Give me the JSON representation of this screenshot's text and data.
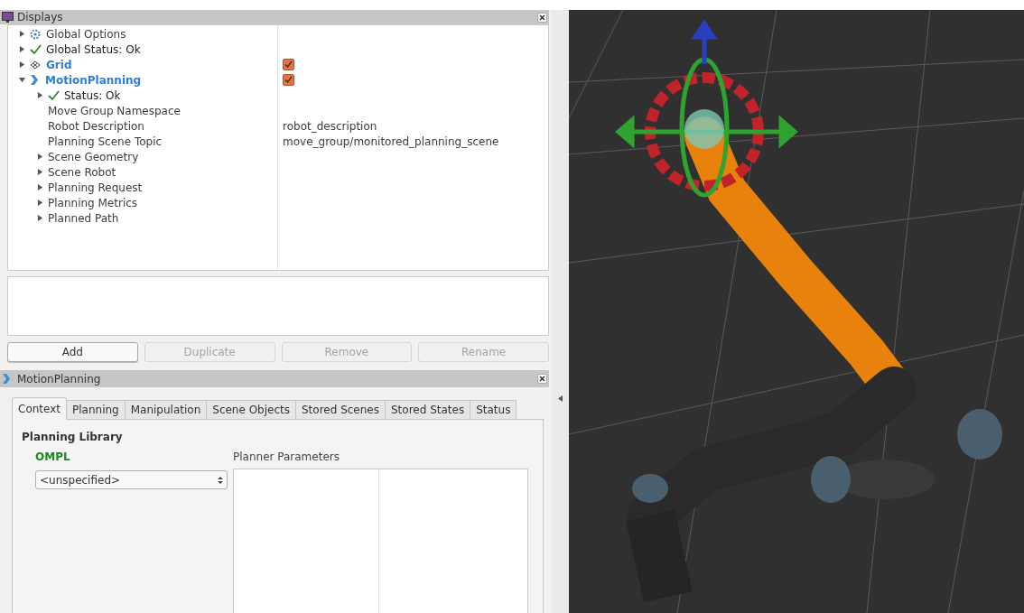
{
  "displays": {
    "title": "Displays",
    "tree": [
      {
        "label": "Global Options",
        "kind": "options",
        "expanded": false
      },
      {
        "label": "Global Status: Ok",
        "kind": "status",
        "expanded": false
      },
      {
        "label": "Grid",
        "kind": "grid",
        "expanded": false,
        "checked": true
      },
      {
        "label": "MotionPlanning",
        "kind": "plugin",
        "expanded": true,
        "checked": true,
        "children": [
          {
            "label": "Status: Ok",
            "kind": "status",
            "expanded": false
          },
          {
            "label": "Move Group Namespace",
            "kind": "property"
          },
          {
            "label": "Robot Description",
            "kind": "property",
            "value": "robot_description"
          },
          {
            "label": "Planning Scene Topic",
            "kind": "property",
            "value": "move_group/monitored_planning_scene"
          },
          {
            "label": "Scene Geometry",
            "kind": "property",
            "expanded": false
          },
          {
            "label": "Scene Robot",
            "kind": "property",
            "expanded": false
          },
          {
            "label": "Planning Request",
            "kind": "property",
            "expanded": false
          },
          {
            "label": "Planning Metrics",
            "kind": "property",
            "expanded": false
          },
          {
            "label": "Planned Path",
            "kind": "property",
            "expanded": false
          }
        ]
      }
    ],
    "buttons": [
      {
        "label": "Add",
        "disabled": false
      },
      {
        "label": "Duplicate",
        "disabled": true
      },
      {
        "label": "Remove",
        "disabled": true
      },
      {
        "label": "Rename",
        "disabled": true
      }
    ]
  },
  "motion_planning": {
    "title": "MotionPlanning",
    "tabs": [
      {
        "label": "Context",
        "selected": true
      },
      {
        "label": "Planning",
        "selected": false
      },
      {
        "label": "Manipulation",
        "selected": false
      },
      {
        "label": "Scene Objects",
        "selected": false
      },
      {
        "label": "Stored Scenes",
        "selected": false
      },
      {
        "label": "Stored States",
        "selected": false
      },
      {
        "label": "Status",
        "selected": false
      }
    ],
    "section_title": "Planning Library",
    "library": "OMPL",
    "planner_select": {
      "value": "<unspecified>"
    },
    "parameters_label": "Planner Parameters"
  }
}
